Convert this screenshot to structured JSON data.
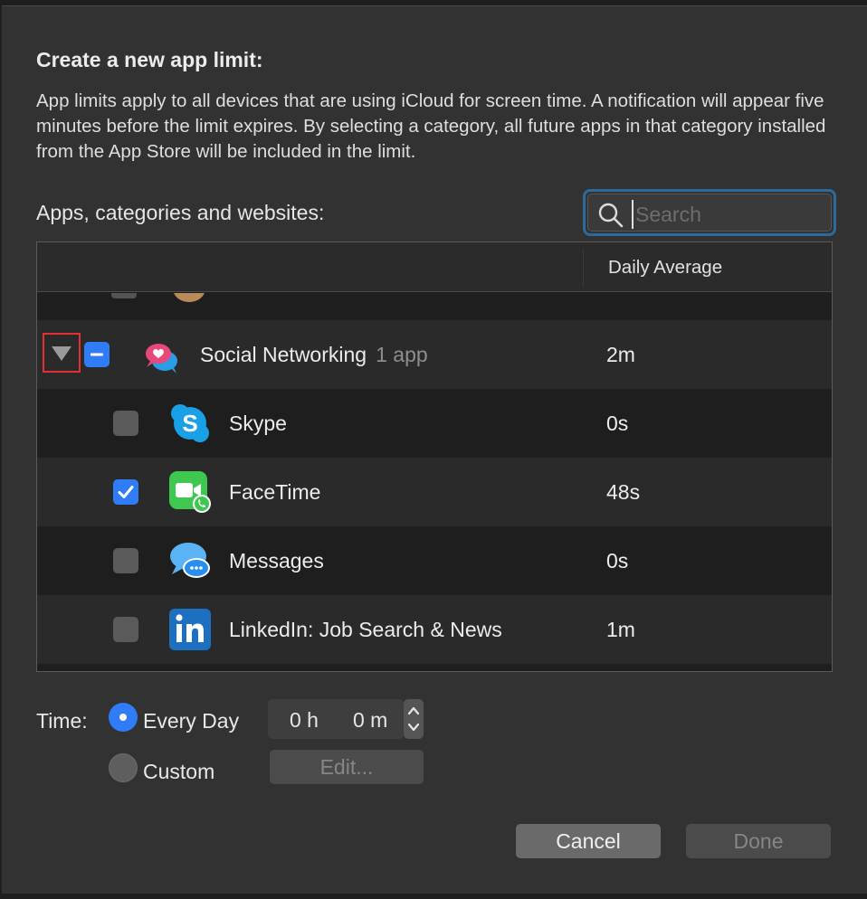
{
  "dialog": {
    "title": "Create a new app limit:",
    "description": "App limits apply to all devices that are using iCloud for screen time. A notification will appear five minutes before the limit expires. By selecting a category, all future apps in that category installed from the App Store will be included in the limit.",
    "list_label": "Apps, categories and websites:"
  },
  "search": {
    "placeholder": "Search",
    "value": ""
  },
  "table": {
    "column_daily_average": "Daily Average",
    "category": {
      "name": "Social Networking",
      "sub": "1 app",
      "avg": "2m",
      "state": "mixed",
      "expanded": true
    },
    "apps": [
      {
        "name": "Skype",
        "avg": "0s",
        "checked": false,
        "icon": "skype-icon"
      },
      {
        "name": "FaceTime",
        "avg": "48s",
        "checked": true,
        "icon": "facetime-icon"
      },
      {
        "name": "Messages",
        "avg": "0s",
        "checked": false,
        "icon": "messages-icon"
      },
      {
        "name": "LinkedIn: Job Search & News",
        "avg": "1m",
        "checked": false,
        "icon": "linkedin-icon"
      }
    ]
  },
  "time": {
    "label": "Time:",
    "every_day_label": "Every Day",
    "custom_label": "Custom",
    "selected": "every_day",
    "hours": "0 h",
    "minutes": "0 m",
    "edit_label": "Edit..."
  },
  "buttons": {
    "cancel": "Cancel",
    "done": "Done"
  },
  "colors": {
    "accent": "#2f7cf6",
    "focus_ring": "#2c6a9c",
    "highlight_box": "#e03030"
  }
}
